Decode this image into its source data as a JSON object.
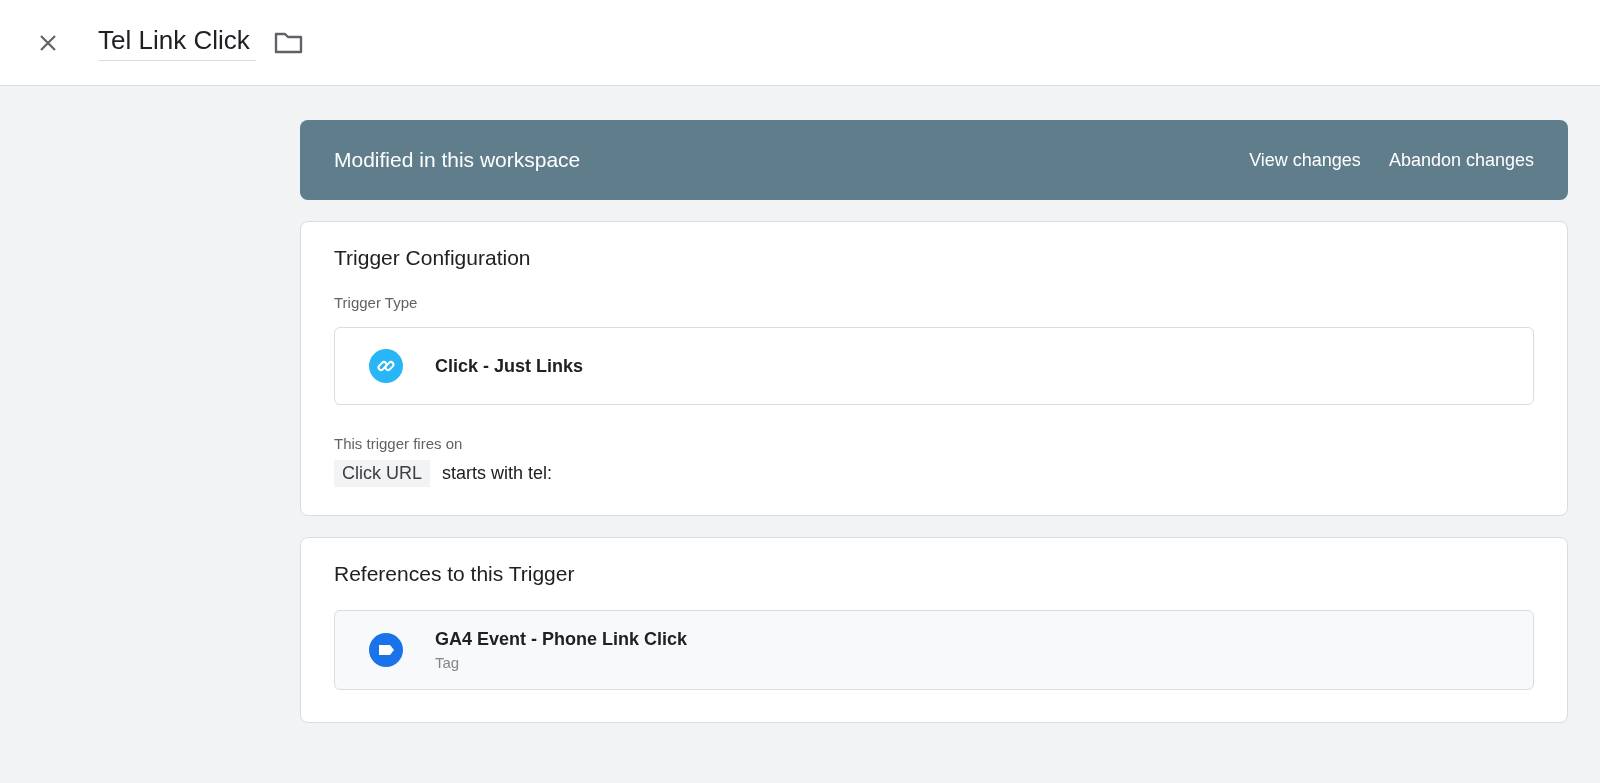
{
  "header": {
    "title": "Tel Link Click"
  },
  "banner": {
    "text": "Modified in this workspace",
    "actions": [
      "View changes",
      "Abandon changes"
    ]
  },
  "trigger_configuration": {
    "title": "Trigger Configuration",
    "type_label": "Trigger Type",
    "trigger_type": {
      "kind": "link",
      "name": "Click - Just Links"
    },
    "fires_on_label": "This trigger fires on",
    "condition": {
      "variable": "Click URL",
      "rule": "starts with tel:"
    }
  },
  "references": {
    "title": "References to this Trigger",
    "items": [
      {
        "kind": "tag",
        "name": "GA4 Event - Phone Link Click",
        "type": "Tag"
      }
    ]
  }
}
